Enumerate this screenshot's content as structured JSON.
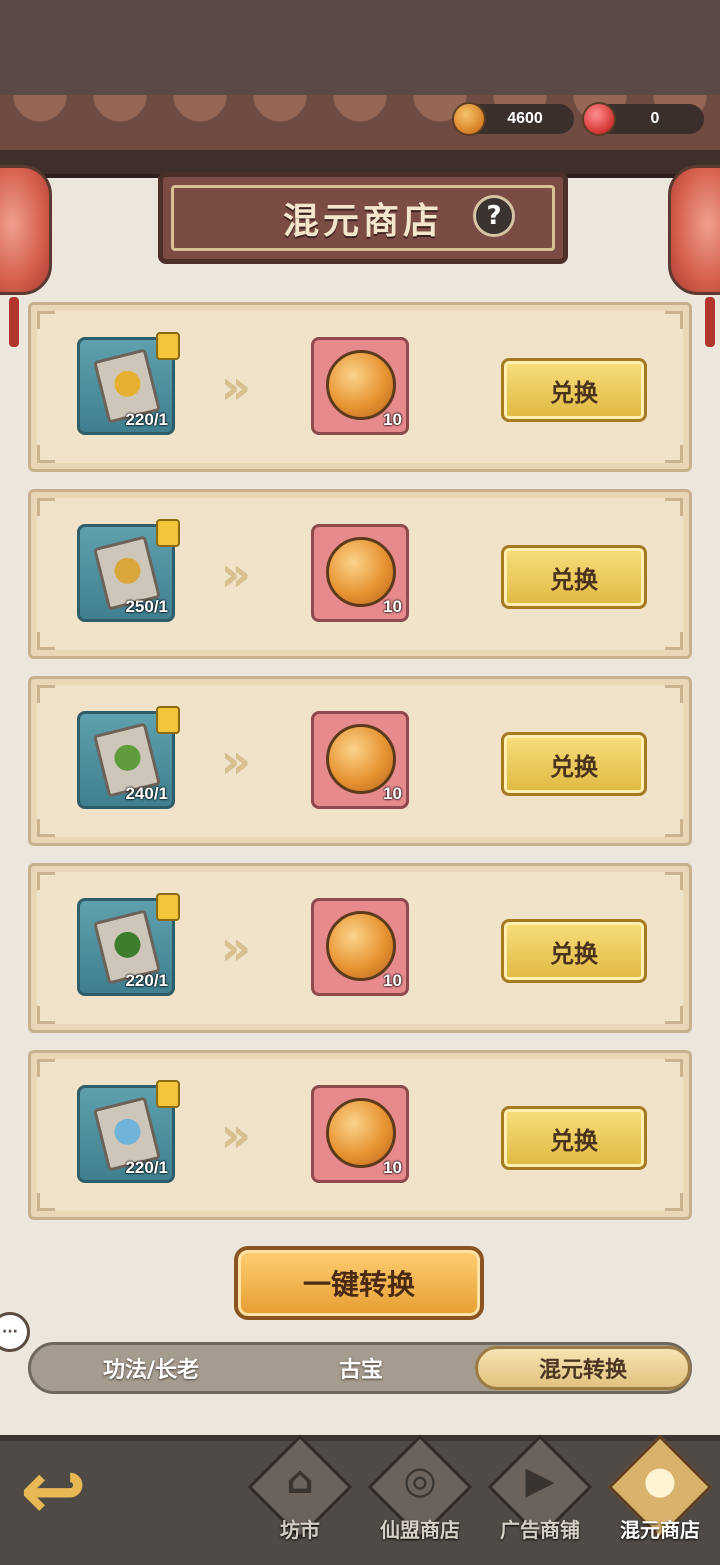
{
  "currencies": [
    {
      "icon": "gold-coin-icon",
      "value": "4600"
    },
    {
      "icon": "red-orb-icon",
      "value": "0"
    }
  ],
  "header": {
    "title": "混元商店",
    "help": "?"
  },
  "exchange_rows": [
    {
      "book_emblem": "lightning-book-icon",
      "emblem_color": "#e6b030",
      "count": "220/1",
      "reward_count": "10",
      "button": "兑换"
    },
    {
      "book_emblem": "shield-book-icon",
      "emblem_color": "#d9a63a",
      "count": "250/1",
      "reward_count": "10",
      "button": "兑换"
    },
    {
      "book_emblem": "leaf-book-icon",
      "emblem_color": "#5f9d3c",
      "count": "240/1",
      "reward_count": "10",
      "button": "兑换"
    },
    {
      "book_emblem": "poison-book-icon",
      "emblem_color": "#3f7d2e",
      "count": "220/1",
      "reward_count": "10",
      "button": "兑换"
    },
    {
      "book_emblem": "water-book-icon",
      "emblem_color": "#6fb3d9",
      "count": "220/1",
      "reward_count": "10",
      "button": "兑换"
    }
  ],
  "convert_all": "一键转换",
  "tabs": [
    {
      "label": "功法/长老",
      "active": false
    },
    {
      "label": "古宝",
      "active": false
    },
    {
      "label": "混元转换",
      "active": true
    }
  ],
  "nav": [
    {
      "label": "坊市",
      "icon": "pagoda-icon",
      "active": false
    },
    {
      "label": "仙盟商店",
      "icon": "coin-shop-icon",
      "active": false
    },
    {
      "label": "广告商铺",
      "icon": "video-play-icon",
      "active": false
    },
    {
      "label": "混元商店",
      "icon": "orb-shop-icon",
      "active": true
    }
  ],
  "colors": {
    "accent_gold": "#e0b842",
    "panel": "#f1e3c9",
    "header_plaque": "#7a4c44"
  }
}
